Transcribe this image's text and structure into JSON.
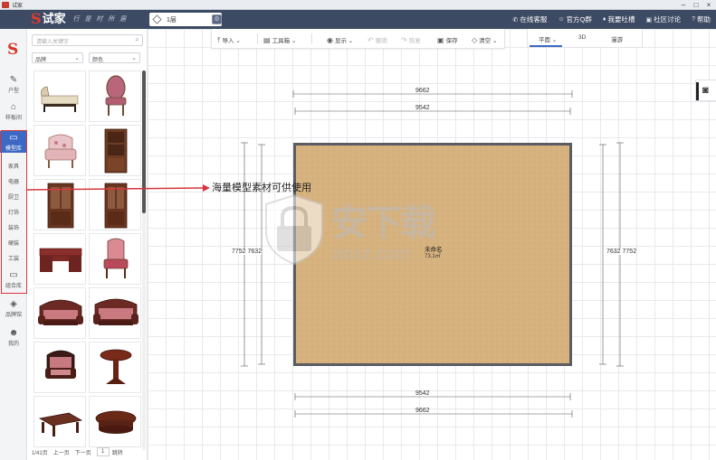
{
  "window": {
    "title": "试家",
    "controls": [
      "–",
      "□",
      "×"
    ]
  },
  "topnav": {
    "logo_mark": "S",
    "logo_name": "试家",
    "slogan": "行 是 时 所 居",
    "floor_select": "1层",
    "links": [
      {
        "icon": "phone-icon",
        "glyph": "✆",
        "label": "在线客服"
      },
      {
        "icon": "user-icon",
        "glyph": "☺",
        "label": "官方Q群"
      },
      {
        "icon": "mic-icon",
        "glyph": "♦",
        "label": "我要吐槽"
      },
      {
        "icon": "community-icon",
        "glyph": "▣",
        "label": "社区讨论"
      },
      {
        "icon": "help-icon",
        "glyph": "?",
        "label": "帮助"
      }
    ]
  },
  "sidebar": {
    "brand": "S",
    "items": [
      {
        "name": "户型",
        "glyph": "✎",
        "icon": "pencil-icon"
      },
      {
        "name": "样板间",
        "glyph": "⌂",
        "icon": "home-icon"
      },
      {
        "name": "模型库",
        "glyph": "▭",
        "icon": "model-library-icon",
        "active": true
      },
      {
        "name": "组合库",
        "glyph": "▭",
        "icon": "combo-library-icon"
      },
      {
        "name": "品牌馆",
        "glyph": "◈",
        "icon": "brand-icon"
      },
      {
        "name": "我的",
        "glyph": "☻",
        "icon": "user-profile-icon"
      }
    ],
    "categories": [
      "家具",
      "电器",
      "厨卫",
      "灯饰",
      "装饰",
      "硬装",
      "工装"
    ]
  },
  "panel": {
    "search_placeholder": "请输入关键字",
    "filters": [
      "品牌",
      "颜色"
    ],
    "items": [
      {
        "name": "chaise-lounge"
      },
      {
        "name": "oval-back-chair"
      },
      {
        "name": "floral-armchair"
      },
      {
        "name": "wooden-bookcase"
      },
      {
        "name": "glass-cabinet"
      },
      {
        "name": "tall-bookcase"
      },
      {
        "name": "writing-desk"
      },
      {
        "name": "red-armchair"
      },
      {
        "name": "carved-sofa"
      },
      {
        "name": "carved-loveseat"
      },
      {
        "name": "dark-armchair"
      },
      {
        "name": "round-side-table"
      },
      {
        "name": "coffee-table"
      },
      {
        "name": "round-coffee-table"
      }
    ],
    "pager": {
      "page_info": "1/41页",
      "prev": "上一页",
      "next": "下一页",
      "current": "1",
      "go": "跳转"
    }
  },
  "toolbar": {
    "import": "导入",
    "toolbox": "工具箱",
    "display": "显示",
    "undo": "撤销",
    "redo": "恢复",
    "save": "保存",
    "clear": "清空"
  },
  "view_tabs": {
    "plan": "平面",
    "three_d": "3D",
    "roam": "漫游",
    "active": "plan"
  },
  "canvas": {
    "dim_top_outer": "9662",
    "dim_top_inner": "9542",
    "dim_bottom_inner": "9542",
    "dim_bottom_outer": "9662",
    "dim_left": "7752 7632",
    "dim_right": "7632 7752",
    "room_label": "未命名",
    "room_area": "73.1㎡"
  },
  "annotation": {
    "text": "海量模型素材可供使用",
    "color": "#d8363c"
  },
  "watermark": {
    "cn": "安下载",
    "en": "anxz.com"
  },
  "colors": {
    "nav_bg": "#3d4a63",
    "accent": "#3d69c4",
    "highlight": "#d8363c",
    "wall": "#5a5c61",
    "floor": "#d6b27f"
  }
}
